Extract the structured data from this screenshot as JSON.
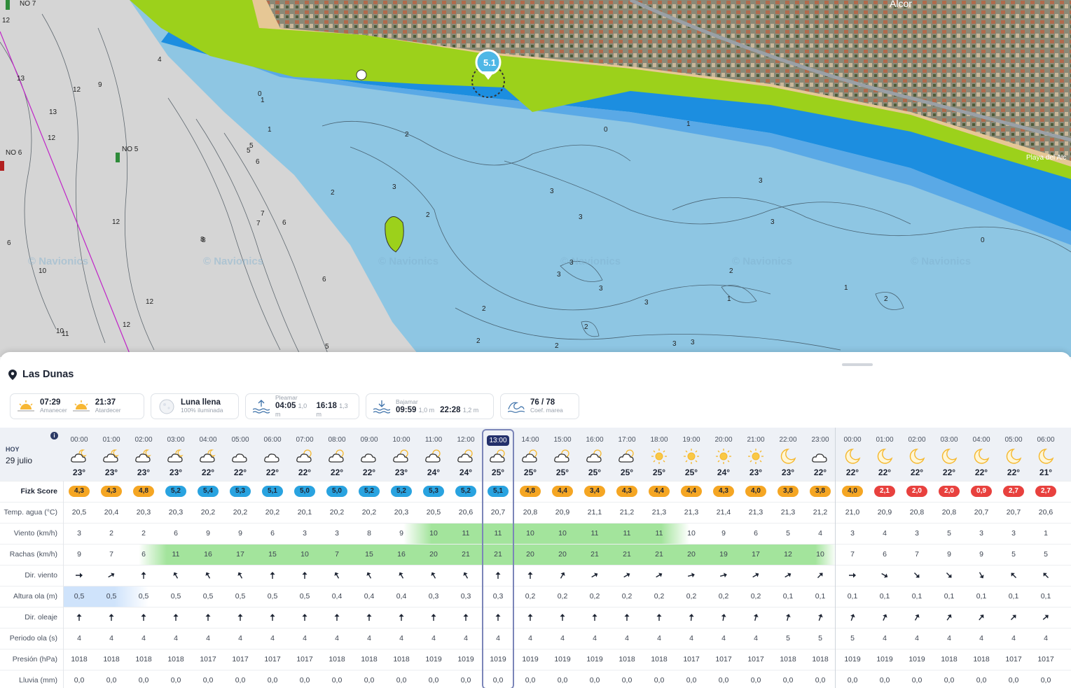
{
  "location": {
    "name": "Las Dunas"
  },
  "map": {
    "marker_label": "5.1",
    "town_label": "Alcor",
    "beach_label": "Playa del Alc",
    "buoys": [
      "NO 7",
      "NO 6",
      "NO 5"
    ],
    "watermark": "© Navionics",
    "depth_labels": [
      "12",
      "13",
      "12",
      "9",
      "13",
      "12",
      "12",
      "6",
      "8",
      "10",
      "12",
      "12",
      "10",
      "11",
      "4",
      "5",
      "5",
      "6",
      "7",
      "7",
      "6",
      "8",
      "6",
      "5",
      "0",
      "1",
      "1",
      "2",
      "2",
      "3",
      "2",
      "3",
      "3",
      "3",
      "3",
      "3",
      "2",
      "2",
      "2",
      "2",
      "3",
      "3",
      "3",
      "1",
      "1",
      "2",
      "2",
      "3",
      "3",
      "0",
      "1",
      "0"
    ]
  },
  "info_cards": {
    "sunrise": {
      "time": "07:29",
      "label": "Amanecer"
    },
    "sunset": {
      "time": "21:37",
      "label": "Atardecer"
    },
    "moon": {
      "title": "Luna llena",
      "subtitle": "100% iluminada"
    },
    "high_tide": {
      "label": "Pleamar",
      "t1": "04:05",
      "h1": "1,0 m",
      "t2": "16:18",
      "h2": "1,3 m"
    },
    "low_tide": {
      "label": "Bajamar",
      "t1": "09:59",
      "h1": "1,0 m",
      "t2": "22:28",
      "h2": "1,2 m"
    },
    "coef": {
      "value": "76 / 78",
      "label": "Coef. marea"
    }
  },
  "header": {
    "today": "HOY",
    "date": "29 julio"
  },
  "hours": [
    "00:00",
    "01:00",
    "02:00",
    "03:00",
    "04:00",
    "05:00",
    "06:00",
    "07:00",
    "08:00",
    "09:00",
    "10:00",
    "11:00",
    "12:00",
    "13:00",
    "14:00",
    "15:00",
    "16:00",
    "17:00",
    "18:00",
    "19:00",
    "20:00",
    "21:00",
    "22:00",
    "23:00",
    "00:00",
    "01:00",
    "02:00",
    "03:00",
    "04:00",
    "05:00",
    "06:00"
  ],
  "selected_index": 13,
  "weather_icons": [
    "partly-cloudy-night",
    "partly-cloudy-night",
    "partly-cloudy-night",
    "partly-cloudy-night",
    "partly-cloudy-night",
    "cloudy",
    "cloudy",
    "partly-cloudy",
    "partly-cloudy",
    "cloudy",
    "partly-cloudy",
    "partly-cloudy",
    "partly-cloudy",
    "partly-cloudy",
    "partly-cloudy",
    "partly-cloudy",
    "partly-cloudy",
    "partly-cloudy",
    "sunny",
    "sunny",
    "sunny",
    "sunny",
    "moon",
    "cloudy",
    "moon",
    "moon",
    "moon",
    "moon",
    "moon",
    "moon",
    "moon"
  ],
  "air_temps": [
    "23°",
    "23°",
    "23°",
    "23°",
    "22°",
    "22°",
    "22°",
    "22°",
    "22°",
    "22°",
    "23°",
    "24°",
    "24°",
    "25°",
    "25°",
    "25°",
    "25°",
    "25°",
    "25°",
    "25°",
    "24°",
    "23°",
    "23°",
    "22°",
    "22°",
    "22°",
    "22°",
    "22°",
    "22°",
    "22°",
    "21°"
  ],
  "rows": {
    "fizk": {
      "label": "Fizk Score",
      "values": [
        "4,3",
        "4,3",
        "4,8",
        "5,2",
        "5,4",
        "5,3",
        "5,1",
        "5,0",
        "5,0",
        "5,2",
        "5,2",
        "5,3",
        "5,2",
        "5,1",
        "4,8",
        "4,4",
        "3,4",
        "4,3",
        "4,4",
        "4,4",
        "4,3",
        "4,0",
        "3,8",
        "3,8",
        "4,0",
        "2,1",
        "2,0",
        "2,0",
        "0,9",
        "2,7",
        "2,7"
      ]
    },
    "water_temp": {
      "label": "Temp. agua (°C)",
      "values": [
        "20,5",
        "20,4",
        "20,3",
        "20,3",
        "20,2",
        "20,2",
        "20,2",
        "20,1",
        "20,2",
        "20,2",
        "20,3",
        "20,5",
        "20,6",
        "20,7",
        "20,8",
        "20,9",
        "21,1",
        "21,2",
        "21,3",
        "21,3",
        "21,4",
        "21,3",
        "21,3",
        "21,2",
        "21,0",
        "20,9",
        "20,8",
        "20,8",
        "20,7",
        "20,7",
        "20,6"
      ]
    },
    "wind": {
      "label": "Viento (km/h)",
      "values": [
        "3",
        "2",
        "2",
        "6",
        "9",
        "9",
        "6",
        "3",
        "3",
        "8",
        "9",
        "10",
        "11",
        "11",
        "10",
        "10",
        "11",
        "11",
        "11",
        "10",
        "9",
        "6",
        "5",
        "4",
        "3",
        "4",
        "3",
        "5",
        "3",
        "3",
        "1"
      ]
    },
    "gusts": {
      "label": "Rachas (km/h)",
      "values": [
        "9",
        "7",
        "6",
        "11",
        "16",
        "17",
        "15",
        "10",
        "7",
        "15",
        "16",
        "20",
        "21",
        "21",
        "20",
        "20",
        "21",
        "21",
        "21",
        "20",
        "19",
        "17",
        "12",
        "10",
        "7",
        "6",
        "7",
        "9",
        "9",
        "5",
        "5"
      ]
    },
    "wind_dir": {
      "label": "Dir. viento",
      "values": [
        90,
        60,
        0,
        330,
        330,
        330,
        0,
        0,
        330,
        330,
        330,
        330,
        330,
        0,
        0,
        30,
        60,
        60,
        60,
        75,
        75,
        60,
        60,
        45,
        90,
        120,
        135,
        135,
        150,
        315,
        315
      ]
    },
    "wave_height": {
      "label": "Altura ola (m)",
      "values": [
        "0,5",
        "0,5",
        "0,5",
        "0,5",
        "0,5",
        "0,5",
        "0,5",
        "0,5",
        "0,4",
        "0,4",
        "0,4",
        "0,3",
        "0,3",
        "0,3",
        "0,2",
        "0,2",
        "0,2",
        "0,2",
        "0,2",
        "0,2",
        "0,2",
        "0,2",
        "0,1",
        "0,1",
        "0,1",
        "0,1",
        "0,1",
        "0,1",
        "0,1",
        "0,1",
        "0,1"
      ]
    },
    "wave_dir": {
      "label": "Dir. oleaje",
      "values": [
        0,
        0,
        0,
        0,
        0,
        0,
        0,
        0,
        0,
        0,
        0,
        0,
        0,
        0,
        0,
        0,
        0,
        0,
        0,
        5,
        10,
        15,
        15,
        20,
        20,
        25,
        30,
        35,
        40,
        45,
        50
      ]
    },
    "wave_period": {
      "label": "Periodo ola (s)",
      "values": [
        "4",
        "4",
        "4",
        "4",
        "4",
        "4",
        "4",
        "4",
        "4",
        "4",
        "4",
        "4",
        "4",
        "4",
        "4",
        "4",
        "4",
        "4",
        "4",
        "4",
        "4",
        "4",
        "5",
        "5",
        "5",
        "4",
        "4",
        "4",
        "4",
        "4",
        "4"
      ]
    },
    "pressure": {
      "label": "Presión (hPa)",
      "values": [
        "1018",
        "1018",
        "1018",
        "1018",
        "1017",
        "1017",
        "1017",
        "1017",
        "1018",
        "1018",
        "1018",
        "1019",
        "1019",
        "1019",
        "1019",
        "1019",
        "1019",
        "1018",
        "1018",
        "1017",
        "1017",
        "1017",
        "1018",
        "1018",
        "1019",
        "1019",
        "1019",
        "1018",
        "1018",
        "1017",
        "1017"
      ]
    },
    "rain": {
      "label": "Lluvia (mm)",
      "values": [
        "0,0",
        "0,0",
        "0,0",
        "0,0",
        "0,0",
        "0,0",
        "0,0",
        "0,0",
        "0,0",
        "0,0",
        "0,0",
        "0,0",
        "0,0",
        "0,0",
        "0,0",
        "0,0",
        "0,0",
        "0,0",
        "0,0",
        "0,0",
        "0,0",
        "0,0",
        "0,0",
        "0,0",
        "0,0",
        "0,0",
        "0,0",
        "0,0",
        "0,0",
        "0,0",
        "0,0"
      ]
    }
  },
  "colors": {
    "orange": "#f5a623",
    "blue": "#29a3e0",
    "red": "#e8413e",
    "green": "#a3e49c",
    "lightblue": "#cfe3fb"
  }
}
